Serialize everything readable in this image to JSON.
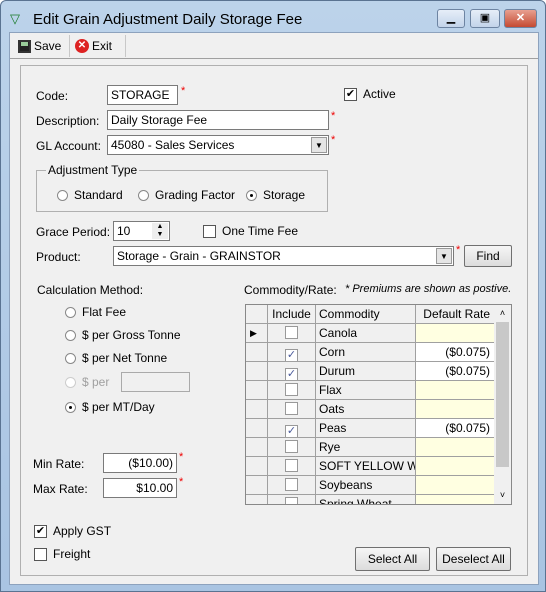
{
  "window": {
    "title": "Edit Grain Adjustment Daily Storage Fee",
    "minimize": "▁",
    "maximize": "▣",
    "close": "✕"
  },
  "toolbar": {
    "save_label": "Save",
    "exit_label": "Exit"
  },
  "form": {
    "code_label": "Code:",
    "code_value": "STORAGE",
    "active_label": "Active",
    "active_checked": true,
    "description_label": "Description:",
    "description_value": "Daily Storage Fee",
    "gl_label": "GL Account:",
    "gl_value": "45080 - Sales Services",
    "adjustment_type": {
      "legend": "Adjustment Type",
      "options": [
        "Standard",
        "Grading Factor",
        "Storage"
      ],
      "selected": "Storage"
    },
    "grace_label": "Grace Period:",
    "grace_value": "10",
    "one_time_label": "One Time Fee",
    "product_label": "Product:",
    "product_value": "Storage - Grain - GRAINSTOR",
    "find_label": "Find",
    "calc_label": "Calculation Method:",
    "calc_options": [
      "Flat Fee",
      "$ per Gross Tonne",
      "$ per Net Tonne",
      "$ per",
      "$ per MT/Day"
    ],
    "calc_selected": "$ per MT/Day",
    "min_label": "Min Rate:",
    "min_value": "($10.00)",
    "max_label": "Max Rate:",
    "max_value": "$10.00",
    "gst_label": "Apply GST",
    "gst_checked": true,
    "freight_label": "Freight",
    "required_mark": "*"
  },
  "grid": {
    "label": "Commodity/Rate:",
    "note": "* Premiums are shown as postive.",
    "headers": [
      "Include",
      "Commodity",
      "Default Rate"
    ],
    "rows": [
      {
        "include": false,
        "commodity": "Canola",
        "rate": ""
      },
      {
        "include": true,
        "commodity": "Corn",
        "rate": "($0.075)"
      },
      {
        "include": true,
        "commodity": "Durum",
        "rate": "($0.075)"
      },
      {
        "include": false,
        "commodity": "Flax",
        "rate": ""
      },
      {
        "include": false,
        "commodity": "Oats",
        "rate": ""
      },
      {
        "include": true,
        "commodity": "Peas",
        "rate": "($0.075)"
      },
      {
        "include": false,
        "commodity": "Rye",
        "rate": ""
      },
      {
        "include": false,
        "commodity": "SOFT YELLOW WI",
        "rate": ""
      },
      {
        "include": false,
        "commodity": "Soybeans",
        "rate": ""
      },
      {
        "include": false,
        "commodity": "Spring Wheat",
        "rate": ""
      }
    ],
    "select_all": "Select All",
    "deselect_all": "Deselect All"
  }
}
